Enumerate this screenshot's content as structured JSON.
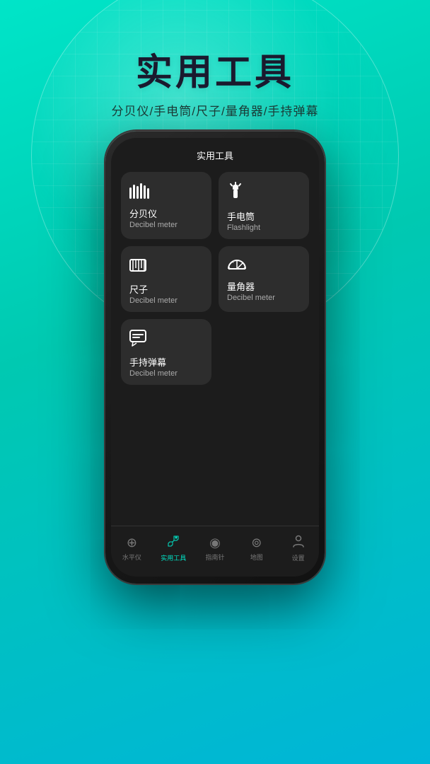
{
  "background": {
    "gradient_start": "#00e5c8",
    "gradient_end": "#00b5d8"
  },
  "header": {
    "main_title": "实用工具",
    "sub_title": "分贝仪/手电筒/尺子/量角器/手持弹幕"
  },
  "phone": {
    "screen_title": "实用工具",
    "tools": [
      {
        "id": "decibel",
        "name_cn": "分贝仪",
        "name_en": "Decibel meter",
        "icon": "decibel-icon"
      },
      {
        "id": "flashlight",
        "name_cn": "手电筒",
        "name_en": "Flashlight",
        "icon": "flashlight-icon"
      },
      {
        "id": "ruler",
        "name_cn": "尺子",
        "name_en": "Decibel meter",
        "icon": "ruler-icon"
      },
      {
        "id": "protractor",
        "name_cn": "量角器",
        "name_en": "Decibel meter",
        "icon": "protractor-icon"
      },
      {
        "id": "bullet",
        "name_cn": "手持弹幕",
        "name_en": "Decibel meter",
        "icon": "bullet-icon"
      }
    ],
    "nav": [
      {
        "id": "level",
        "label": "水平仪",
        "icon": "⊕",
        "active": false
      },
      {
        "id": "tools",
        "label": "实用工具",
        "icon": "🔧",
        "active": true
      },
      {
        "id": "compass",
        "label": "指南针",
        "icon": "◉",
        "active": false
      },
      {
        "id": "map",
        "label": "地图",
        "icon": "⊚",
        "active": false
      },
      {
        "id": "settings",
        "label": "设置",
        "icon": "👤",
        "active": false
      }
    ]
  }
}
